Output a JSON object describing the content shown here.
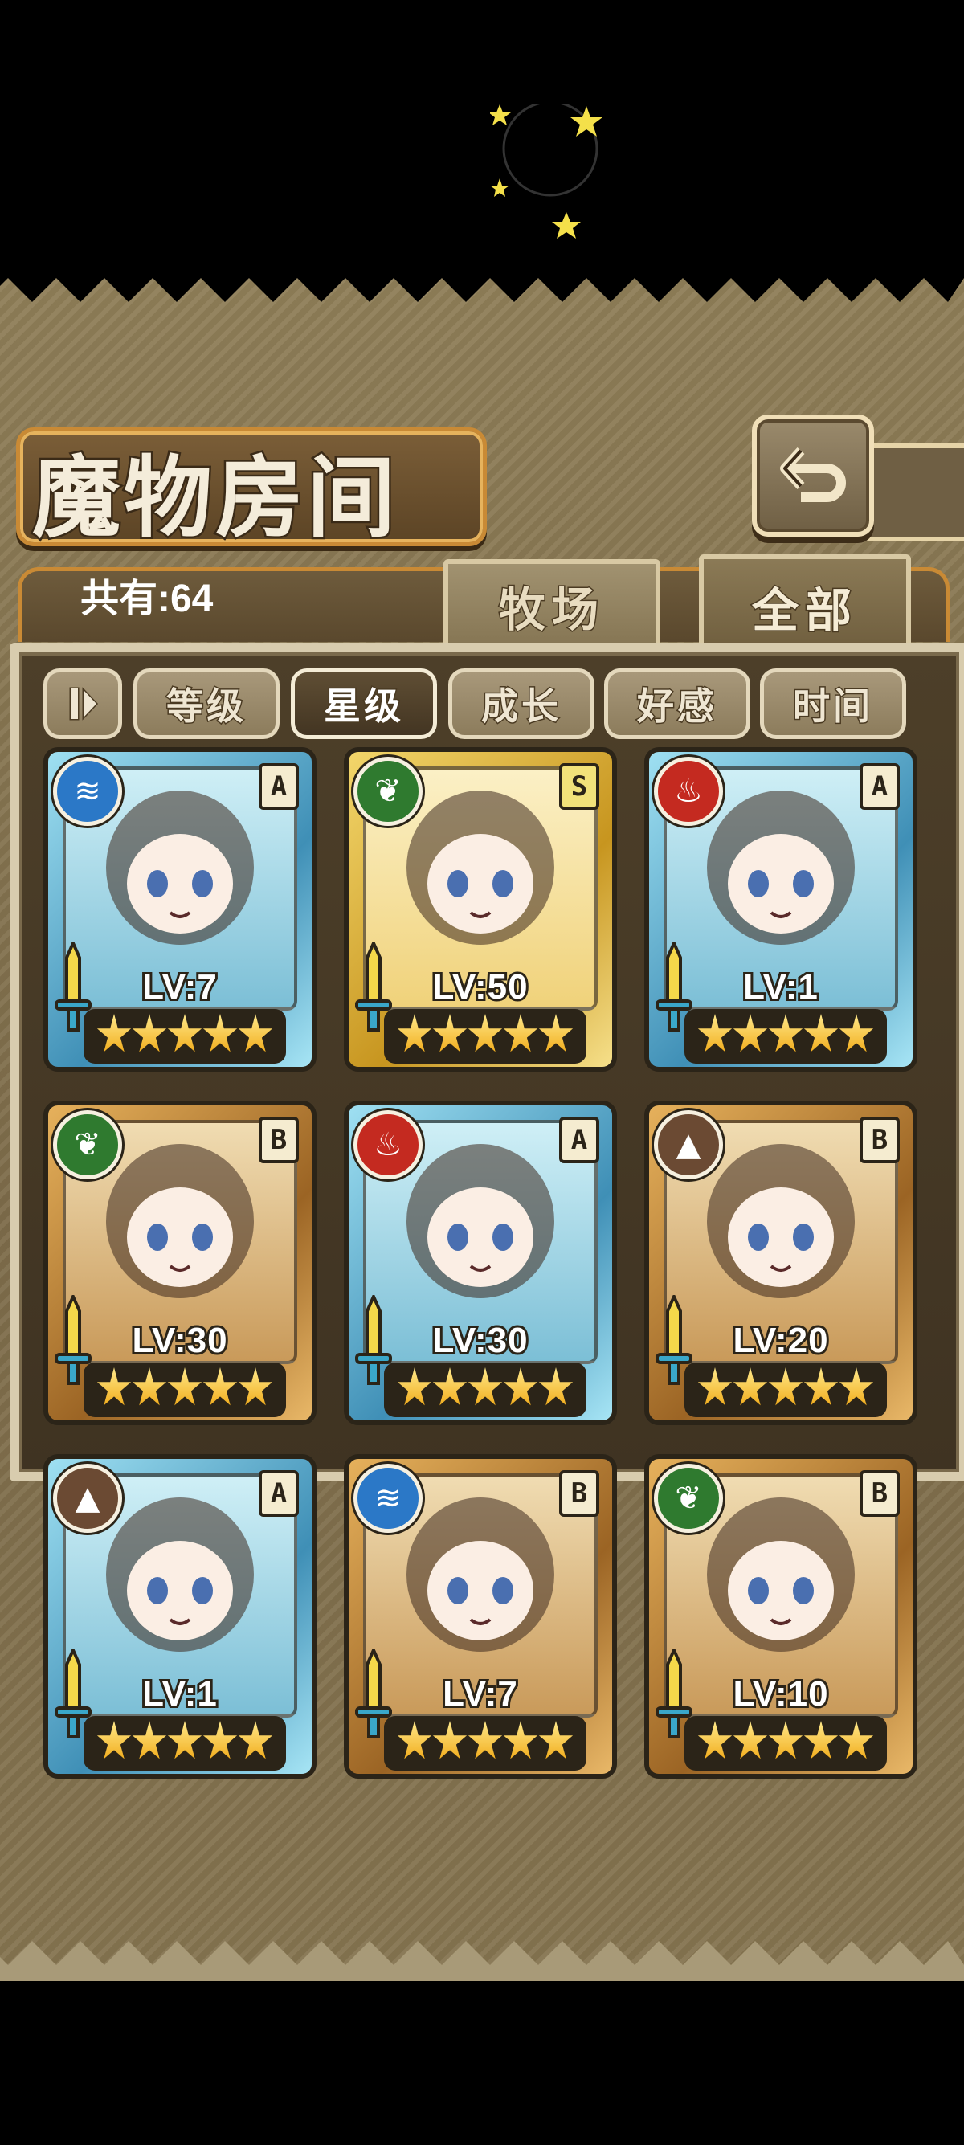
{
  "title": "魔物房间",
  "count_label": "共有:64",
  "tabs": {
    "ranch": "牧场",
    "all": "全部"
  },
  "sort_buttons": [
    "等级",
    "星级",
    "成长",
    "好感",
    "时间"
  ],
  "active_sort": "星级",
  "colors": {
    "water": "#2b78c7",
    "leaf": "#2f7a2f",
    "fire": "#c42a20",
    "earth": "#6b4a33"
  },
  "cards": [
    {
      "element": "water",
      "element_icon": "water-wave-icon",
      "rank": "A",
      "level": "LV:7",
      "frame": "blue",
      "stars": 5
    },
    {
      "element": "leaf",
      "element_icon": "leaf-icon",
      "rank": "S",
      "level": "LV:50",
      "frame": "gold",
      "stars": 5
    },
    {
      "element": "fire",
      "element_icon": "flame-icon",
      "rank": "A",
      "level": "LV:1",
      "frame": "blue",
      "stars": 5
    },
    {
      "element": "leaf",
      "element_icon": "leaf-icon",
      "rank": "B",
      "level": "LV:30",
      "frame": "bronze",
      "stars": 5
    },
    {
      "element": "fire",
      "element_icon": "flame-icon",
      "rank": "A",
      "level": "LV:30",
      "frame": "blue",
      "stars": 5
    },
    {
      "element": "earth",
      "element_icon": "mountain-icon",
      "rank": "B",
      "level": "LV:20",
      "frame": "bronze",
      "stars": 5
    },
    {
      "element": "earth",
      "element_icon": "mountain-icon",
      "rank": "A",
      "level": "LV:1",
      "frame": "blue",
      "stars": 5
    },
    {
      "element": "water",
      "element_icon": "water-wave-icon",
      "rank": "B",
      "level": "LV:7",
      "frame": "bronze",
      "stars": 5
    },
    {
      "element": "leaf",
      "element_icon": "leaf-icon",
      "rank": "B",
      "level": "LV:10",
      "frame": "bronze",
      "stars": 5
    }
  ]
}
